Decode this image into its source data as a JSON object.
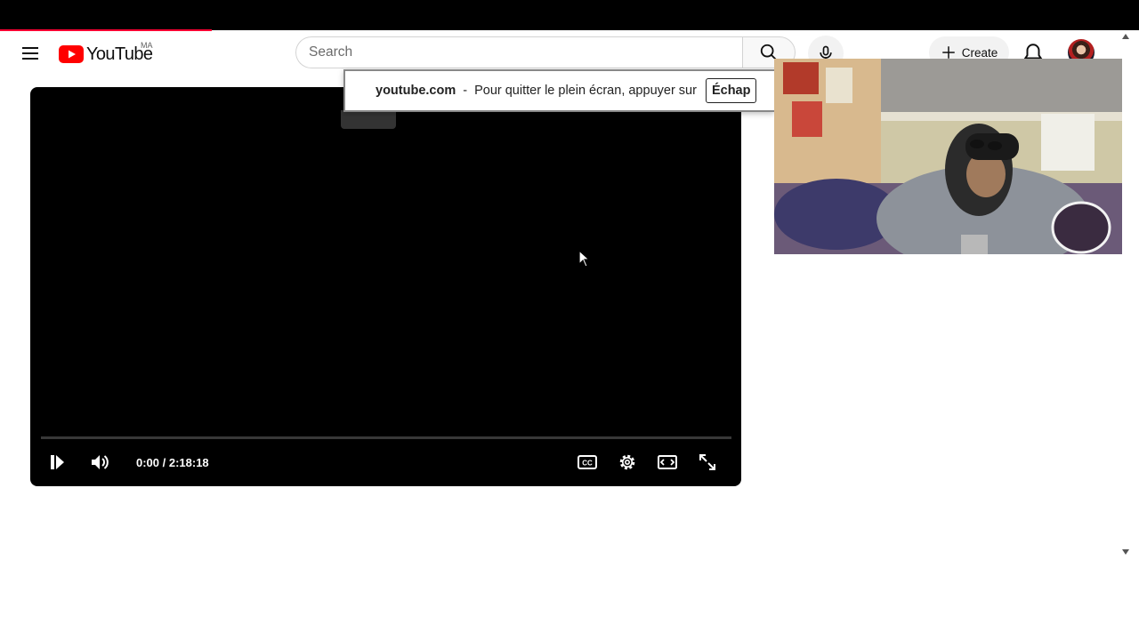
{
  "browser": {
    "progress_fraction": 0.186
  },
  "masthead": {
    "logo_text": "YouTube",
    "country_code": "MA",
    "search_placeholder": "Search",
    "create_label": "Create",
    "brand_color": "#ff0033"
  },
  "player": {
    "time_current": "0:00",
    "time_total": "2:18:18",
    "time_display": "0:00 / 2:18:18",
    "progress": 0
  },
  "fullscreen_toast": {
    "domain": "youtube.com",
    "separator": "-",
    "message": "Pour quitter le plein écran, appuyer sur",
    "key": "Échap"
  },
  "icons": [
    "menu-icon",
    "youtube-logo-icon",
    "search-icon",
    "mic-icon",
    "plus-icon",
    "bell-icon",
    "pause-icon",
    "volume-icon",
    "captions-icon",
    "settings-icon",
    "theater-icon",
    "fullscreen-icon",
    "cursor-icon"
  ]
}
